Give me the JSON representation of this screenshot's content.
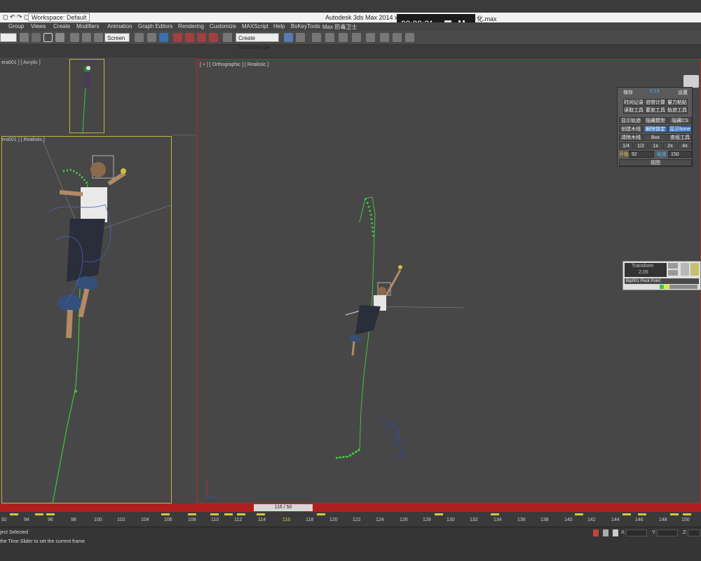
{
  "titlebar": {
    "quick_access": "◻ ↶ ↷ ◻",
    "workspace": "Workspace: Default",
    "app_title": "Autodesk 3ds Max  2014 x64",
    "file_name": "化.max"
  },
  "recorder": {
    "time": "00:09:31"
  },
  "menu": [
    "Group",
    "Views",
    "Create",
    "Modifiers",
    "Animation",
    "Graph Editors",
    "Rendering",
    "Customize",
    "MAXScript",
    "Help",
    "BsKeyTools",
    "Max 防毒卫士"
  ],
  "toolbar": {
    "view_dropdown": "Screen",
    "selection_set": "Create Selection Se"
  },
  "viewports": {
    "left_top_label": "era001 ] [ Acrylic ]",
    "left_label": "era001 ] [ Realistic ]",
    "right_label": "[ + ] [ Orthographic ] [ Realistic ]"
  },
  "panel": {
    "save": "保存",
    "version": "0.13",
    "settings": "设置",
    "row1": [
      "时间记录",
      "验带计算",
      "量力粘贴"
    ],
    "row2": [
      "读取工具",
      "蒙皮工具",
      "轨迹工具"
    ],
    "row3": [
      "显示轨迹",
      "隐藏模型",
      "隐藏CS"
    ],
    "row4": [
      "创建木线",
      "解除锁定",
      "显示bone"
    ],
    "row5": [
      "清除木线",
      "Box",
      "查组工具"
    ],
    "speed": [
      "1/4",
      "1/2",
      "1x",
      "2x",
      "4x"
    ],
    "start_label": "开始",
    "start_value": "92",
    "end_label": "结束",
    "end_value": "150",
    "view_button": "视图"
  },
  "minipanel": {
    "title": "Transform",
    "value": "2.05",
    "pivot": "Bip001 Pivot Point"
  },
  "timeline": {
    "slider": "116 / 50",
    "ticks": [
      "92",
      "94",
      "96",
      "98",
      "100",
      "102",
      "104",
      "106",
      "108",
      "110",
      "112",
      "114",
      "116",
      "118",
      "120",
      "122",
      "124",
      "126",
      "128",
      "130",
      "132",
      "134",
      "136",
      "138",
      "140",
      "142",
      "144",
      "146",
      "148",
      "150"
    ]
  },
  "status": {
    "selection": "ject Selected",
    "prompt": "the Time Slider to set the current frame",
    "x_label": "X:",
    "y_label": "Y:",
    "z_label": "Z:"
  }
}
